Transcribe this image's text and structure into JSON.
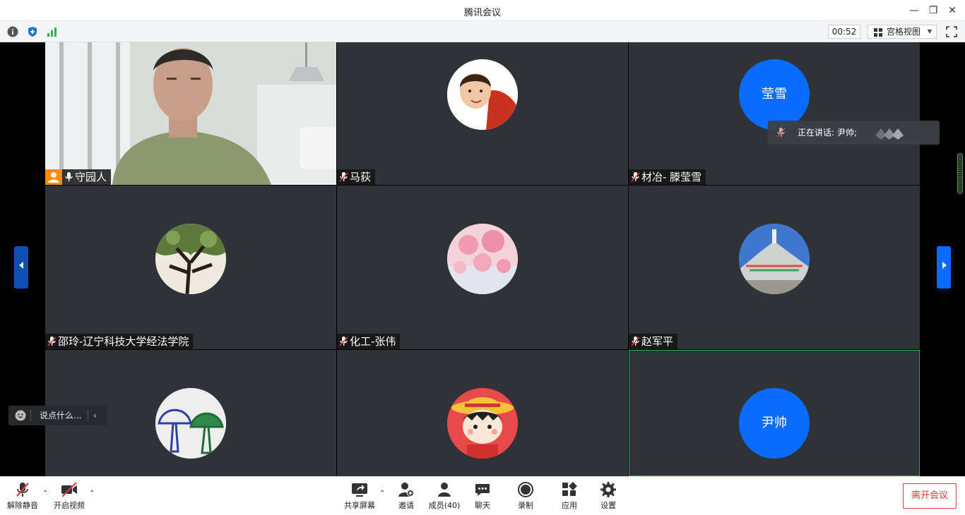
{
  "window": {
    "title": "腾讯会议"
  },
  "infobar": {
    "timer": "00:52",
    "view_label": "宫格视图"
  },
  "tiles": [
    {
      "name": "守园人",
      "host": true
    },
    {
      "name": "马荻"
    },
    {
      "name": "材冶- 滕莹雪",
      "avatar_text": "莹雪"
    },
    {
      "name": "邵玲-辽宁科技大学经法学院"
    },
    {
      "name": "化工-张伟"
    },
    {
      "name": "赵军平"
    },
    {
      "name": ""
    },
    {
      "name": ""
    },
    {
      "name": "",
      "avatar_text": "尹帅"
    }
  ],
  "speaking": {
    "label": "正在讲话: 尹帅;"
  },
  "chat": {
    "placeholder": "说点什么..."
  },
  "toolbar": {
    "unmute": "解除静音",
    "start_video": "开启视频",
    "share_screen": "共享屏幕",
    "invite": "邀请",
    "members": "成员(40)",
    "chat": "聊天",
    "record": "录制",
    "apps": "应用",
    "settings": "设置",
    "leave": "离开会议"
  },
  "colors": {
    "accent": "#0a6cff",
    "tile_bg": "#2f3237",
    "leave": "#e33b3b",
    "host": "#ff8a00",
    "active_border": "#1fb35a"
  }
}
